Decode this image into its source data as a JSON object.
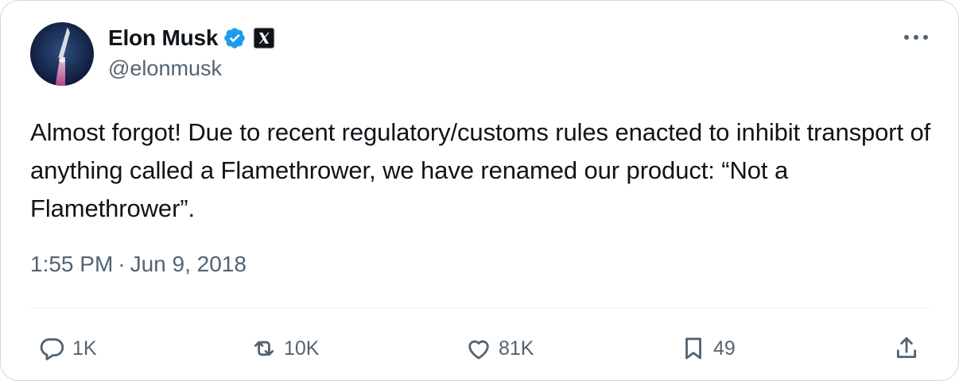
{
  "tweet": {
    "author": {
      "display_name": "Elon Musk",
      "handle": "@elonmusk",
      "verified_icon": "verified-badge-icon",
      "affiliation_icon": "x-logo-icon"
    },
    "text": "Almost forgot! Due to recent regulatory/customs rules enacted to inhibit transport of anything called a Flamethrower, we have renamed our product: “Not a Flamethrower”.",
    "time": "1:55 PM",
    "separator": "·",
    "date": "Jun 9, 2018",
    "actions": {
      "replies": "1K",
      "reposts": "10K",
      "likes": "81K",
      "bookmarks": "49"
    }
  },
  "colors": {
    "text_primary": "#0f1419",
    "text_secondary": "#536471",
    "verified_blue": "#1d9bf0",
    "border": "#cfd9de",
    "divider": "#eff3f4"
  },
  "icons": [
    "avatar",
    "verified-badge-icon",
    "x-logo-icon",
    "more-options-icon",
    "reply-icon",
    "repost-icon",
    "like-icon",
    "bookmark-icon",
    "share-icon"
  ]
}
